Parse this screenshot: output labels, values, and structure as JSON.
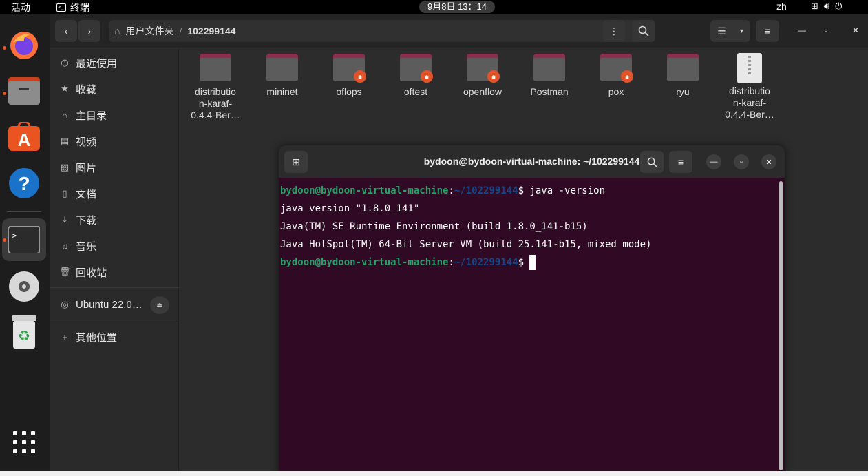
{
  "topbar": {
    "activities": "活动",
    "app_name": "终端",
    "clock": "9月8日  13：14",
    "lang": "zh"
  },
  "dock": {
    "items": [
      "firefox-icon",
      "files-icon",
      "app-center-icon",
      "help-icon",
      "terminal-icon",
      "disc-icon",
      "trash-icon",
      "show-apps-icon"
    ]
  },
  "files": {
    "path_home": "用户文件夹",
    "path_current": "102299144",
    "sidebar": [
      {
        "label": "最近使用",
        "icon": "clock-icon"
      },
      {
        "label": "收藏",
        "icon": "star-icon"
      },
      {
        "label": "主目录",
        "icon": "home-icon"
      },
      {
        "label": "视频",
        "icon": "video-icon"
      },
      {
        "label": "图片",
        "icon": "picture-icon"
      },
      {
        "label": "文档",
        "icon": "document-icon"
      },
      {
        "label": "下载",
        "icon": "download-icon"
      },
      {
        "label": "音乐",
        "icon": "music-icon"
      },
      {
        "label": "回收站",
        "icon": "trash-icon"
      }
    ],
    "device": "Ubuntu 22.0…",
    "other_locations": "其他位置",
    "items": [
      {
        "l1": "distributio",
        "l2": "n-karaf-",
        "l3": "0.4.4-Ber…",
        "type": "folder",
        "locked": false
      },
      {
        "l1": "mininet",
        "l2": "",
        "l3": "",
        "type": "folder",
        "locked": false
      },
      {
        "l1": "oflops",
        "l2": "",
        "l3": "",
        "type": "folder",
        "locked": true
      },
      {
        "l1": "oftest",
        "l2": "",
        "l3": "",
        "type": "folder",
        "locked": true
      },
      {
        "l1": "openflow",
        "l2": "",
        "l3": "",
        "type": "folder",
        "locked": true
      },
      {
        "l1": "Postman",
        "l2": "",
        "l3": "",
        "type": "folder",
        "locked": false
      },
      {
        "l1": "pox",
        "l2": "",
        "l3": "",
        "type": "folder",
        "locked": true
      },
      {
        "l1": "ryu",
        "l2": "",
        "l3": "",
        "type": "folder",
        "locked": false
      },
      {
        "l1": "distributio",
        "l2": "n-karaf-",
        "l3": "0.4.4-Ber…",
        "type": "archive",
        "locked": false
      }
    ]
  },
  "terminal": {
    "title": "bydoon@bydoon-virtual-machine: ~/102299144",
    "prompt_user": "bydoon@bydoon-virtual-machine",
    "prompt_path": "~/102299144",
    "command": "java -version",
    "output": [
      "java version \"1.8.0_141\"",
      "Java(TM) SE Runtime Environment (build 1.8.0_141-b15)",
      "Java HotSpot(TM) 64-Bit Server VM (build 25.141-b15, mixed mode)"
    ]
  },
  "colors": {
    "terminal_bg": "#300a24",
    "prompt_user": "#26a269",
    "prompt_path": "#12488b",
    "accent": "#e95420"
  }
}
